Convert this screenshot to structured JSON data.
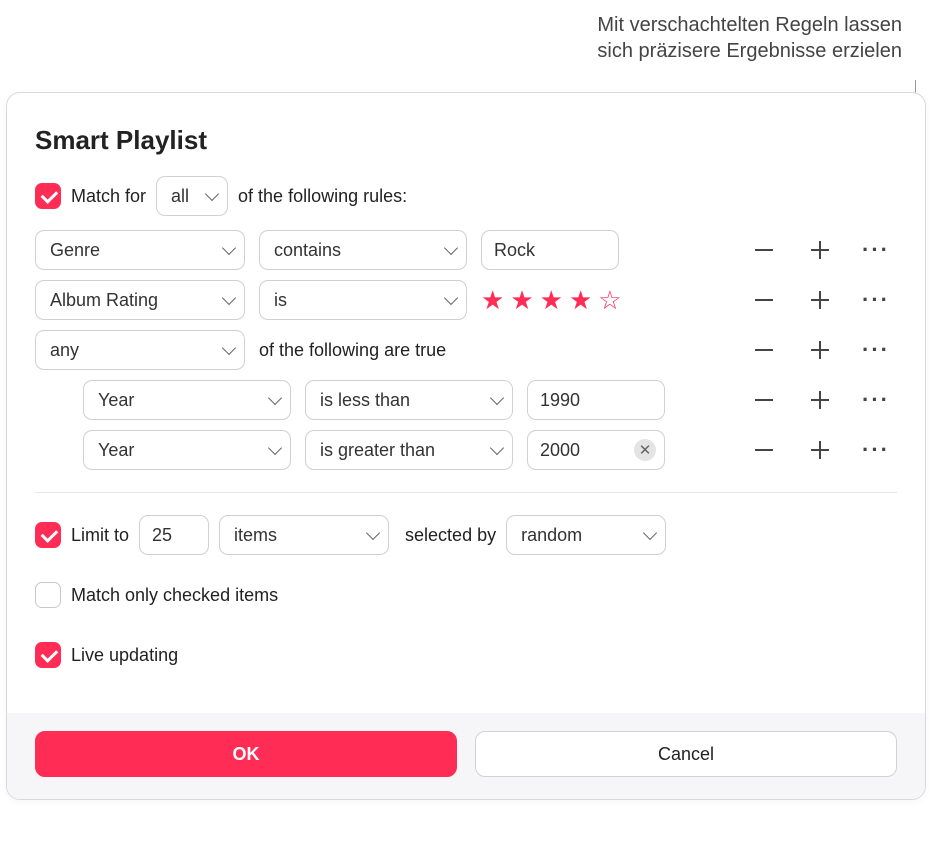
{
  "callout": {
    "line1": "Mit verschachtelten Regeln lassen",
    "line2": "sich präzisere Ergebnisse erzielen"
  },
  "title": "Smart Playlist",
  "match": {
    "enabled": true,
    "pre": "Match  for",
    "quantifier": "all",
    "post": "of the following rules:"
  },
  "rules": [
    {
      "attribute": "Genre",
      "operator": "contains",
      "value": "Rock",
      "type": "text"
    },
    {
      "attribute": "Album Rating",
      "operator": "is",
      "value": 4,
      "type": "rating",
      "max": 5
    },
    {
      "attribute": "any",
      "operator_suffix": "of the following are true",
      "type": "group",
      "children": [
        {
          "attribute": "Year",
          "operator": "is less than",
          "value": "1990",
          "type": "text"
        },
        {
          "attribute": "Year",
          "operator": "is greater than",
          "value": "2000",
          "type": "text",
          "clearable": true
        }
      ]
    }
  ],
  "limit": {
    "enabled": true,
    "label": "Limit to",
    "count": "25",
    "unit": "items",
    "selected_by_label": "selected by",
    "selected_by": "random"
  },
  "match_checked": {
    "enabled": false,
    "label": "Match only checked items"
  },
  "live_updating": {
    "enabled": true,
    "label": "Live updating"
  },
  "buttons": {
    "ok": "OK",
    "cancel": "Cancel"
  }
}
